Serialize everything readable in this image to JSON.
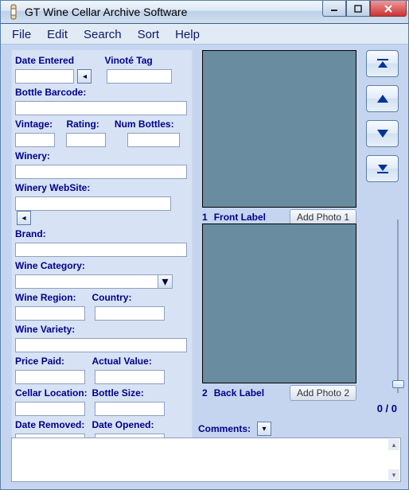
{
  "window": {
    "title": "GT Wine Cellar Archive Software"
  },
  "menu": [
    "File",
    "Edit",
    "Search",
    "Sort",
    "Help"
  ],
  "labels": {
    "date_entered": "Date Entered",
    "vinote_tag": "Vinoté Tag",
    "bottle_barcode": "Bottle Barcode:",
    "vintage": "Vintage:",
    "rating": "Rating:",
    "num_bottles": "Num Bottles:",
    "winery": "Winery:",
    "winery_website": "Winery WebSite:",
    "brand": "Brand:",
    "wine_category": "Wine Category:",
    "wine_region": "Wine Region:",
    "country": "Country:",
    "wine_variety": "Wine Variety:",
    "price_paid": "Price Paid:",
    "actual_value": "Actual Value:",
    "cellar_location": "Cellar Location:",
    "bottle_size": "Bottle Size:",
    "date_removed": "Date Removed:",
    "date_opened": "Date Opened:",
    "comments": "Comments:"
  },
  "values": {
    "date_entered": "",
    "vinote_tag": "",
    "bottle_barcode": "",
    "vintage": "",
    "rating": "",
    "num_bottles": "",
    "winery": "",
    "winery_website": "",
    "brand": "",
    "wine_category": "",
    "wine_region": "",
    "country": "",
    "wine_variety": "",
    "price_paid": "",
    "actual_value": "",
    "cellar_location": "",
    "bottle_size": "",
    "date_removed": "",
    "date_opened": "",
    "comments": ""
  },
  "photos": {
    "label1_num": "1",
    "label1": "Front Label",
    "add1": "Add Photo 1",
    "label2_num": "2",
    "label2": "Back Label",
    "add2": "Add Photo 2"
  },
  "counter": "0 / 0"
}
